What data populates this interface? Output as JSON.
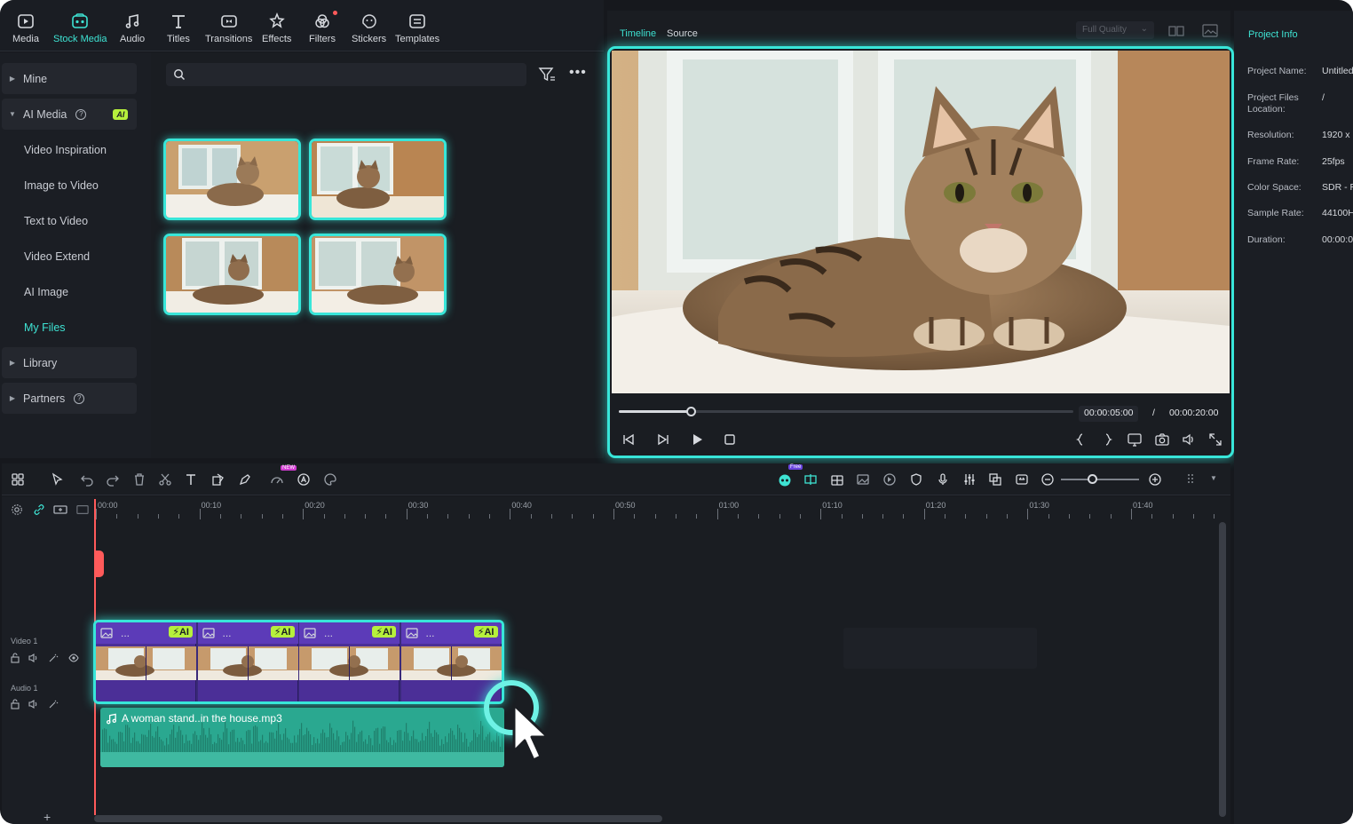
{
  "toolbar": {
    "items": [
      {
        "label": "Media",
        "icon": "media-icon"
      },
      {
        "label": "Stock Media",
        "icon": "stock-media-icon",
        "active": true
      },
      {
        "label": "Audio",
        "icon": "music-note-icon"
      },
      {
        "label": "Titles",
        "icon": "text-t-icon"
      },
      {
        "label": "Transitions",
        "icon": "transitions-icon"
      },
      {
        "label": "Effects",
        "icon": "effects-icon"
      },
      {
        "label": "Filters",
        "icon": "filters-icon"
      },
      {
        "label": "Stickers",
        "icon": "stickers-icon"
      },
      {
        "label": "Templates",
        "icon": "templates-icon"
      }
    ]
  },
  "sidebar": {
    "items": [
      {
        "label": "Mine"
      },
      {
        "label": "AI Media",
        "badge": "AI"
      },
      {
        "label": "Video Inspiration"
      },
      {
        "label": "Image to Video"
      },
      {
        "label": "Text to Video"
      },
      {
        "label": "Video Extend"
      },
      {
        "label": "AI Image"
      },
      {
        "label": "My Files"
      },
      {
        "label": "Library"
      },
      {
        "label": "Partners"
      }
    ]
  },
  "media": {
    "search_placeholder": ""
  },
  "preview": {
    "tabs": [
      "Timeline",
      "Source"
    ],
    "quality": "Full Quality",
    "current_time": "00:00:05:00",
    "separator": "/",
    "total_time": "00:00:20:00",
    "progress": 0.16
  },
  "project_info": {
    "title": "Project Info",
    "rows": [
      {
        "key": "Project Name:",
        "value": "Untitled"
      },
      {
        "key": "Project Files Location:",
        "value": "/"
      },
      {
        "key": "Resolution:",
        "value": "1920 x"
      },
      {
        "key": "Frame Rate:",
        "value": "25fps"
      },
      {
        "key": "Color Space:",
        "value": "SDR - R"
      },
      {
        "key": "Sample Rate:",
        "value": "44100H"
      },
      {
        "key": "Duration:",
        "value": "00:00:0"
      }
    ]
  },
  "timeline": {
    "ruler": [
      "00:00",
      "00:10",
      "00:20",
      "00:30",
      "00:40",
      "00:50",
      "01:00",
      "01:10",
      "01:20",
      "01:30",
      "01:40"
    ],
    "tracks": [
      "Video 1",
      "Audio 1"
    ],
    "clip_badge": "AI",
    "clip_dots": "...",
    "audio_name": "A woman stand..in the house.mp3",
    "add_track": "+",
    "badge_new": "NEW",
    "badge_free": "Free"
  },
  "colors": {
    "accent": "#38e6d9",
    "ai_badge": "#b6f03c",
    "clip": "#4b2f97",
    "audio": "#2aa890",
    "playhead": "#ff5a5a"
  }
}
